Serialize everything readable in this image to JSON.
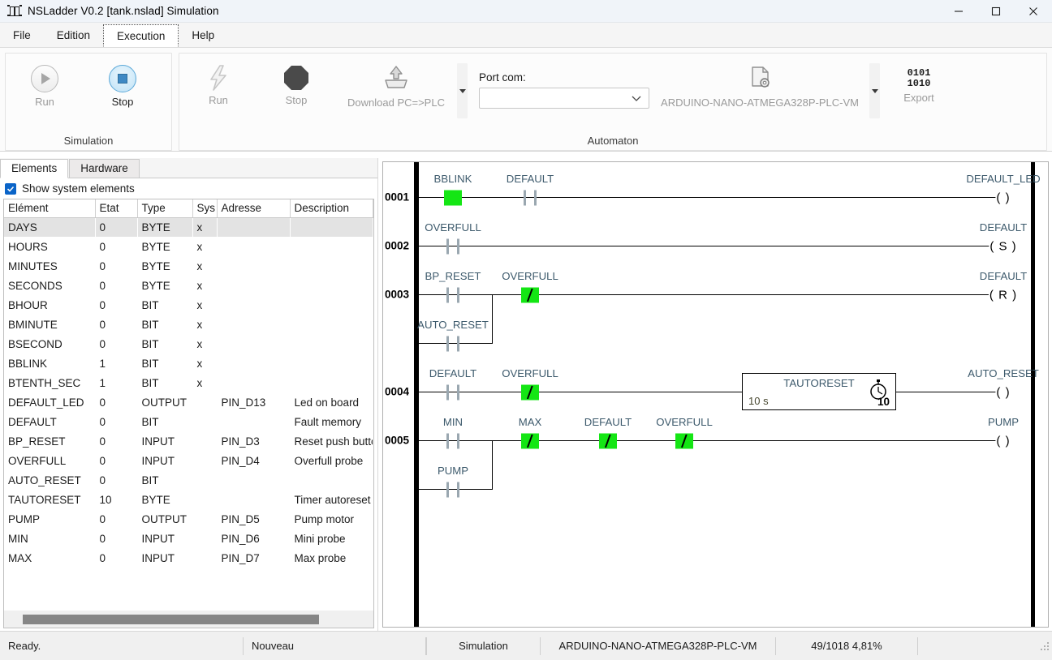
{
  "window": {
    "title": "NSLadder V0.2  [tank.nslad] Simulation",
    "app_icon": "ladder-app-icon",
    "minimize": "minimize-icon",
    "maximize": "maximize-icon",
    "close": "close-icon"
  },
  "menu": {
    "items": [
      {
        "label": "File",
        "active": false
      },
      {
        "label": "Edition",
        "active": false
      },
      {
        "label": "Execution",
        "active": true
      },
      {
        "label": "Help",
        "active": false
      }
    ]
  },
  "ribbon": {
    "groups": [
      {
        "caption": "Simulation",
        "buttons": [
          {
            "label": "Run",
            "icon": "play-circle-icon",
            "enabled": false
          },
          {
            "label": "Stop",
            "icon": "stop-circle-icon",
            "enabled": true
          }
        ]
      },
      {
        "caption": "Automaton",
        "buttons": [
          {
            "label": "Run",
            "icon": "lightning-bolt-icon",
            "enabled": false
          },
          {
            "label": "Stop",
            "icon": "octagon-stop-icon",
            "enabled": false
          },
          {
            "label": "Download PC=>PLC",
            "icon": "upload-tray-icon",
            "enabled": false
          },
          {
            "label": "ARDUINO-NANO-ATMEGA328P-PLC-VM",
            "icon": "document-gear-icon",
            "enabled": false
          },
          {
            "label": "Export",
            "icon": "binary-1010-icon",
            "enabled": false
          }
        ],
        "port": {
          "label": "Port com:",
          "value": "",
          "placeholder": ""
        }
      }
    ]
  },
  "left_panel": {
    "tabs": [
      {
        "label": "Elements",
        "active": true
      },
      {
        "label": "Hardware",
        "active": false
      }
    ],
    "show_system_elements": {
      "label": "Show system elements",
      "checked": true
    },
    "table": {
      "headers": [
        "Elément",
        "Etat",
        "Type",
        "Sys",
        "Adresse",
        "Description"
      ],
      "rows": [
        {
          "element": "DAYS",
          "etat": "0",
          "type": "BYTE",
          "sys": "x",
          "adresse": "",
          "description": "",
          "selected": true
        },
        {
          "element": "HOURS",
          "etat": "0",
          "type": "BYTE",
          "sys": "x",
          "adresse": "",
          "description": "",
          "selected": false
        },
        {
          "element": "MINUTES",
          "etat": "0",
          "type": "BYTE",
          "sys": "x",
          "adresse": "",
          "description": "",
          "selected": false
        },
        {
          "element": "SECONDS",
          "etat": "0",
          "type": "BYTE",
          "sys": "x",
          "adresse": "",
          "description": "",
          "selected": false
        },
        {
          "element": "BHOUR",
          "etat": "0",
          "type": "BIT",
          "sys": "x",
          "adresse": "",
          "description": "",
          "selected": false
        },
        {
          "element": "BMINUTE",
          "etat": "0",
          "type": "BIT",
          "sys": "x",
          "adresse": "",
          "description": "",
          "selected": false
        },
        {
          "element": "BSECOND",
          "etat": "0",
          "type": "BIT",
          "sys": "x",
          "adresse": "",
          "description": "",
          "selected": false
        },
        {
          "element": "BBLINK",
          "etat": "1",
          "type": "BIT",
          "sys": "x",
          "adresse": "",
          "description": "",
          "selected": false
        },
        {
          "element": "BTENTH_SEC",
          "etat": "1",
          "type": "BIT",
          "sys": "x",
          "adresse": "",
          "description": "",
          "selected": false
        },
        {
          "element": "DEFAULT_LED",
          "etat": "0",
          "type": "OUTPUT",
          "sys": "",
          "adresse": "PIN_D13",
          "description": "Led on board",
          "selected": false
        },
        {
          "element": "DEFAULT",
          "etat": "0",
          "type": "BIT",
          "sys": "",
          "adresse": "",
          "description": "Fault memory",
          "selected": false
        },
        {
          "element": "BP_RESET",
          "etat": "0",
          "type": "INPUT",
          "sys": "",
          "adresse": "PIN_D3",
          "description": "Reset push buttc",
          "selected": false
        },
        {
          "element": "OVERFULL",
          "etat": "0",
          "type": "INPUT",
          "sys": "",
          "adresse": "PIN_D4",
          "description": "Overfull probe",
          "selected": false
        },
        {
          "element": "AUTO_RESET",
          "etat": "0",
          "type": "BIT",
          "sys": "",
          "adresse": "",
          "description": "",
          "selected": false
        },
        {
          "element": "TAUTORESET",
          "etat": "10",
          "type": "BYTE",
          "sys": "",
          "adresse": "",
          "description": "Timer autoreset",
          "selected": false
        },
        {
          "element": "PUMP",
          "etat": "0",
          "type": "OUTPUT",
          "sys": "",
          "adresse": "PIN_D5",
          "description": "Pump motor",
          "selected": false
        },
        {
          "element": "MIN",
          "etat": "0",
          "type": "INPUT",
          "sys": "",
          "adresse": "PIN_D6",
          "description": "Mini probe",
          "selected": false
        },
        {
          "element": "MAX",
          "etat": "0",
          "type": "INPUT",
          "sys": "",
          "adresse": "PIN_D7",
          "description": "Max probe",
          "selected": false
        }
      ]
    }
  },
  "ladder": {
    "rungs": [
      {
        "number": "0001"
      },
      {
        "number": "0002"
      },
      {
        "number": "0003"
      },
      {
        "number": "0004"
      },
      {
        "number": "0005"
      }
    ],
    "contacts": [
      {
        "id": "r1-bblink",
        "label": "BBLINK",
        "kind": "NO",
        "active": true
      },
      {
        "id": "r1-default",
        "label": "DEFAULT",
        "kind": "NO",
        "active": false
      },
      {
        "id": "r2-overfull",
        "label": "OVERFULL",
        "kind": "NO",
        "active": false
      },
      {
        "id": "r3-bpreset",
        "label": "BP_RESET",
        "kind": "NO",
        "active": false
      },
      {
        "id": "r3-overfull",
        "label": "OVERFULL",
        "kind": "NC",
        "active": true
      },
      {
        "id": "r3-autoreset",
        "label": "AUTO_RESET",
        "kind": "NO",
        "active": false
      },
      {
        "id": "r4-default",
        "label": "DEFAULT",
        "kind": "NO",
        "active": false
      },
      {
        "id": "r4-overfull",
        "label": "OVERFULL",
        "kind": "NC",
        "active": true
      },
      {
        "id": "r5-min",
        "label": "MIN",
        "kind": "NO",
        "active": false
      },
      {
        "id": "r5-pump",
        "label": "PUMP",
        "kind": "NO",
        "active": false
      },
      {
        "id": "r5-max",
        "label": "MAX",
        "kind": "NC",
        "active": true
      },
      {
        "id": "r5-default",
        "label": "DEFAULT",
        "kind": "NC",
        "active": true
      },
      {
        "id": "r5-overfull",
        "label": "OVERFULL",
        "kind": "NC",
        "active": true
      }
    ],
    "coils": [
      {
        "id": "c1",
        "label": "DEFAULT_LED",
        "symbol": "( )"
      },
      {
        "id": "c2",
        "label": "DEFAULT",
        "symbol": "( S )"
      },
      {
        "id": "c3",
        "label": "DEFAULT",
        "symbol": "( R )"
      },
      {
        "id": "c4",
        "label": "AUTO_RESET",
        "symbol": "( )"
      },
      {
        "id": "c5",
        "label": "PUMP",
        "symbol": "( )"
      }
    ],
    "timer": {
      "name": "TAUTORESET",
      "preset": "10 s",
      "current": "10",
      "icon": "stopwatch-icon"
    }
  },
  "statusbar": {
    "cells": [
      "Ready.",
      "Nouveau",
      "",
      "Simulation",
      "ARDUINO-NANO-ATMEGA328P-PLC-VM",
      "49/1018  4,81%"
    ]
  }
}
